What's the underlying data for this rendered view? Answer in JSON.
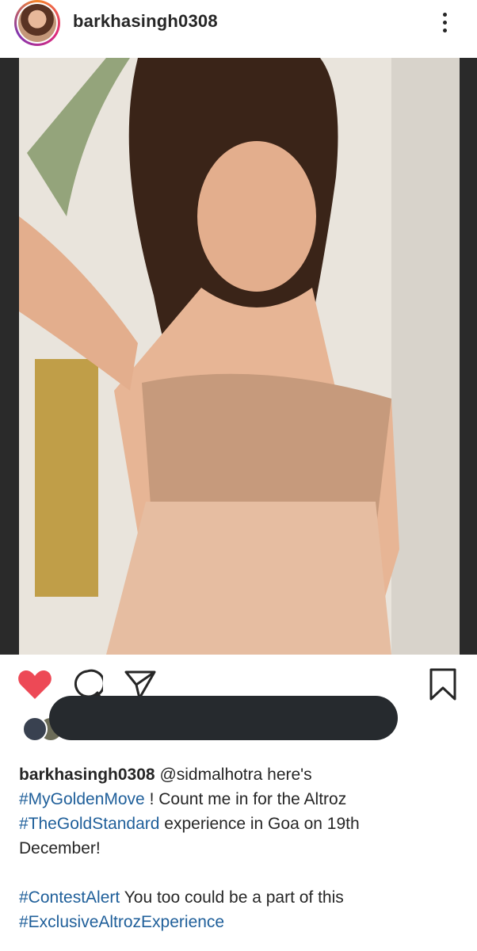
{
  "post": {
    "username": "barkhasingh0308",
    "icons": {
      "more": "more-vertical-icon",
      "like": "heart-filled-icon",
      "comment": "comment-bubble-icon",
      "share": "send-icon",
      "save": "bookmark-icon"
    },
    "caption": {
      "username": "barkhasingh0308",
      "mention": "@sidmalhotra",
      "line1_rest": " here's",
      "tag1": "#MyGoldenMove",
      "line2_rest": " ! Count me in for the Altroz",
      "tag2": "#TheGoldStandard",
      "line3_rest": " experience in Goa on 19th",
      "line4": "December!",
      "tag3": "#ContestAlert",
      "line6_rest": " You too could be a part of this",
      "tag4": "#ExclusiveAltrozExperience"
    }
  },
  "colors": {
    "like_red": "#ed4956",
    "hashtag_blue": "#1f5f9a",
    "text": "#262626"
  }
}
